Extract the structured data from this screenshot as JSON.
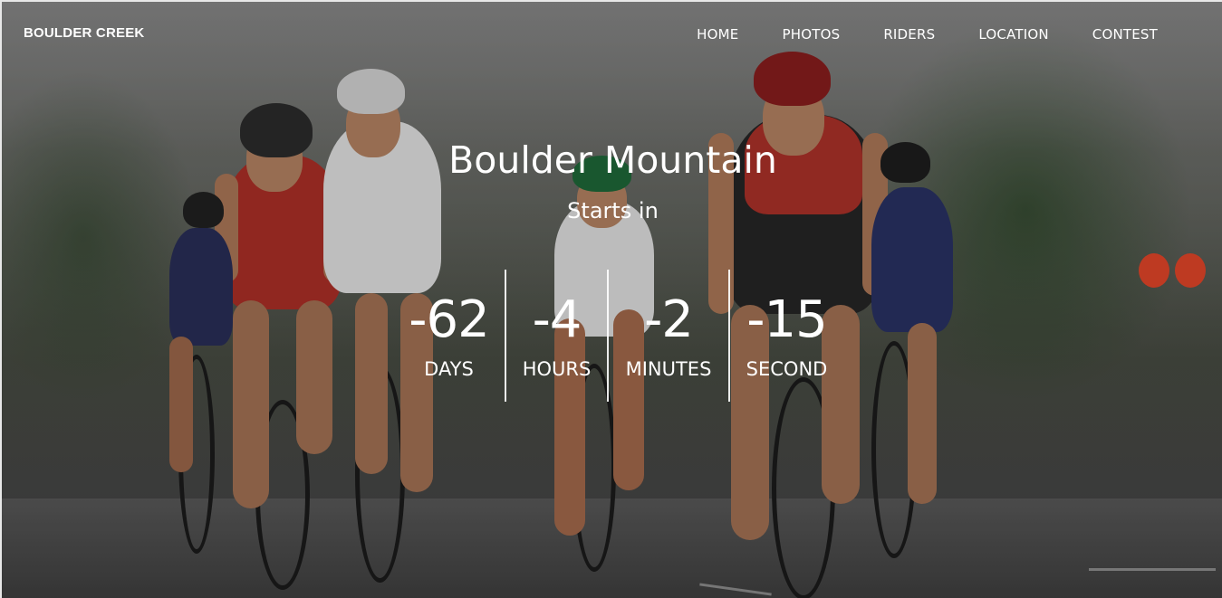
{
  "brand": "BOULDER CREEK",
  "nav": {
    "items": [
      {
        "label": "HOME"
      },
      {
        "label": "PHOTOS"
      },
      {
        "label": "RIDERS"
      },
      {
        "label": "LOCATION"
      },
      {
        "label": "CONTEST"
      }
    ]
  },
  "hero": {
    "title": "Boulder Mountain",
    "subtitle": "Starts in",
    "background": "cyclists-race-photo"
  },
  "countdown": {
    "days": {
      "value": "-62",
      "label": "DAYS"
    },
    "hours": {
      "value": "-4",
      "label": "HOURS"
    },
    "minutes": {
      "value": "-2",
      "label": "MINUTES"
    },
    "seconds": {
      "value": "-15",
      "label": "SECOND"
    }
  }
}
